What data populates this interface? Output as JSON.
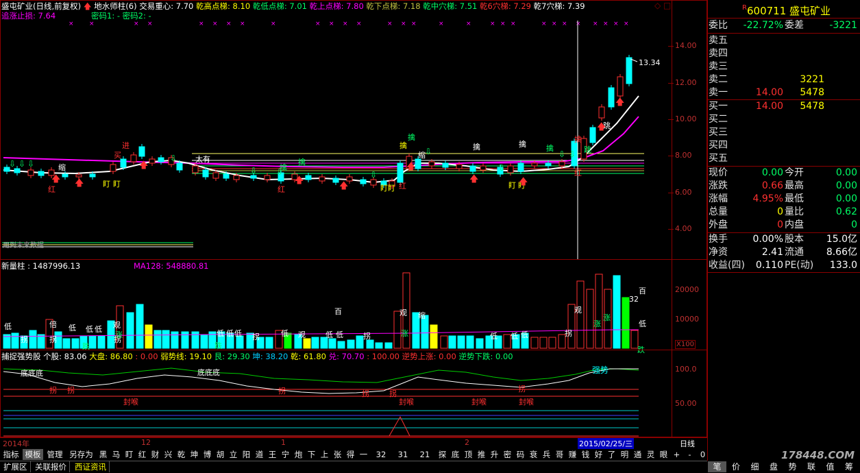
{
  "colors": {
    "red": "#ff3030",
    "green": "#00cc66",
    "cyan": "#00ffff",
    "yellow": "#ffff00",
    "magenta": "#ff00ff",
    "white": "#ffffff",
    "frame": "#8b0000"
  },
  "main_header": {
    "title": "盛屯矿业(日线,前复权)",
    "formula": "地水师柱(6)",
    "items": [
      {
        "label": "交易重心: 7.70",
        "color": "#ffffff"
      },
      {
        "label": "乾高点梯: 8.10",
        "color": "#ffff00"
      },
      {
        "label": "乾低点梯: 7.01",
        "color": "#00ff66"
      },
      {
        "label": "乾上点梯: 7.80",
        "color": "#ff00ff"
      },
      {
        "label": "乾下点梯: 7.18",
        "color": "#c0c040"
      },
      {
        "label": "乾中穴梯: 7.51",
        "color": "#00ff66"
      },
      {
        "label": "乾6穴梯: 7.29",
        "color": "#ff3030"
      },
      {
        "label": "乾7穴梯: 7.39",
        "color": "#ffffff"
      }
    ],
    "line2": "追涨止损: 7.64",
    "line3": "密码1: -  密码2: -"
  },
  "price_axis": [
    "14.00",
    "12.00",
    "10.00",
    "8.00",
    "6.00",
    "4.00"
  ],
  "last_price_label": "13.34",
  "stale_text": "用到未来数据",
  "volume_header": {
    "left": "新量柱 : 1487996.13",
    "ma": "MA128: 548880.81"
  },
  "volume_axis": [
    "20000",
    "10000"
  ],
  "volume_unit": "X100",
  "indicator_header": {
    "name": "捕捉强势股",
    "items": [
      {
        "label": "个股: 83.06",
        "color": "#ffffff"
      },
      {
        "label": "大盘: 86.80",
        "color": "#ffff00"
      },
      {
        "label": ": 0.00",
        "color": "#ff3030"
      },
      {
        "label": "弱势线: 19.10",
        "color": "#ffff00"
      },
      {
        "label": "艮: 29.30",
        "color": "#00ff66"
      },
      {
        "label": "坤: 38.20",
        "color": "#00ccff"
      },
      {
        "label": "乾: 61.80",
        "color": "#ffff00"
      },
      {
        "label": "兑: 70.70",
        "color": "#ff00ff"
      },
      {
        "label": ": 100.00",
        "color": "#ff3030"
      },
      {
        "label": "逆势上涨: 0.00",
        "color": "#ff3030"
      },
      {
        "label": "逆势下跌: 0.00",
        "color": "#00ff66"
      }
    ]
  },
  "indicator_axis": [
    "100.0",
    "50.00"
  ],
  "strong_label": "强势",
  "date_axis": {
    "labels": [
      "2014年",
      "12",
      "1",
      "2"
    ],
    "cursor": "2015/02/25/三",
    "period": "日线"
  },
  "quote": {
    "code": "600711",
    "name": "盛屯矿业",
    "weibi_label": "委比",
    "weibi": "-22.72%",
    "weicha_label": "委差",
    "weicha": "-3221",
    "asks": [
      {
        "label": "卖五",
        "price": "",
        "vol": ""
      },
      {
        "label": "卖四",
        "price": "",
        "vol": ""
      },
      {
        "label": "卖三",
        "price": "",
        "vol": ""
      },
      {
        "label": "卖二",
        "price": "",
        "vol": "3221"
      },
      {
        "label": "卖一",
        "price": "14.00",
        "vol": "5478"
      }
    ],
    "bids": [
      {
        "label": "买一",
        "price": "14.00",
        "vol": "5478"
      },
      {
        "label": "买二",
        "price": "",
        "vol": ""
      },
      {
        "label": "买三",
        "price": "",
        "vol": ""
      },
      {
        "label": "买四",
        "price": "",
        "vol": ""
      },
      {
        "label": "买五",
        "price": "",
        "vol": ""
      }
    ],
    "stats": [
      {
        "l1": "现价",
        "v1": "0.00",
        "c1": "#00ff66",
        "l2": "今开",
        "v2": "0.00",
        "c2": "#00ff66"
      },
      {
        "l1": "涨跌",
        "v1": "0.66",
        "c1": "#ff3030",
        "l2": "最高",
        "v2": "0.00",
        "c2": "#00ff66"
      },
      {
        "l1": "涨幅",
        "v1": "4.95%",
        "c1": "#ff3030",
        "l2": "最低",
        "v2": "0.00",
        "c2": "#00ff66"
      },
      {
        "l1": "总量",
        "v1": "0",
        "c1": "#ffff00",
        "l2": "量比",
        "v2": "0.62",
        "c2": "#00ff66"
      },
      {
        "l1": "外盘",
        "v1": "0",
        "c1": "#ff3030",
        "l2": "内盘",
        "v2": "0",
        "c2": "#00ff66"
      }
    ],
    "stats2": [
      {
        "l1": "换手",
        "v1": "0.00%",
        "l2": "股本",
        "v2": "15.0亿"
      },
      {
        "l1": "净资",
        "v1": "2.41",
        "l2": "流通",
        "v2": "8.66亿"
      },
      {
        "l1": "收益(四)",
        "v1": "0.110",
        "l2": "PE(动)",
        "v2": "133.0"
      }
    ]
  },
  "toolbar": [
    "指标",
    "模板",
    "管理",
    "另存为",
    "黑",
    "马",
    "盯",
    "红",
    "财",
    "兴",
    "乾",
    "坤",
    "博",
    "胡",
    "立",
    "阳",
    "道",
    "王",
    "宁",
    "炮",
    "下",
    "上",
    "张",
    "得",
    "一",
    "32",
    "31",
    "21",
    "探",
    "底",
    "顶",
    "推",
    "升",
    "密",
    "码",
    "衰",
    "兵",
    "哥",
    "赚",
    "钱",
    "好",
    "了",
    "明",
    "通",
    "灵",
    "眼",
    "+",
    "-",
    "0"
  ],
  "bottom_tabs": [
    "扩展区",
    "关联报价",
    "西证资讯"
  ],
  "right_tabs": [
    "笔",
    "价",
    "细",
    "盘",
    "势",
    "联",
    "值",
    "筹"
  ],
  "watermark": "178448.COM",
  "markers": {
    "red": "红",
    "ding": "盯",
    "jin": "进",
    "buy": "买",
    "suo": "缩",
    "tai": "太有",
    "qin": "擒",
    "yao": "跳",
    "low": "低",
    "guai": "拐",
    "bei": "倍",
    "guan": "观",
    "bai": "百",
    "zhang": "涨",
    "die": "跌",
    "di": "底底底",
    "fengou": "封喉"
  }
}
